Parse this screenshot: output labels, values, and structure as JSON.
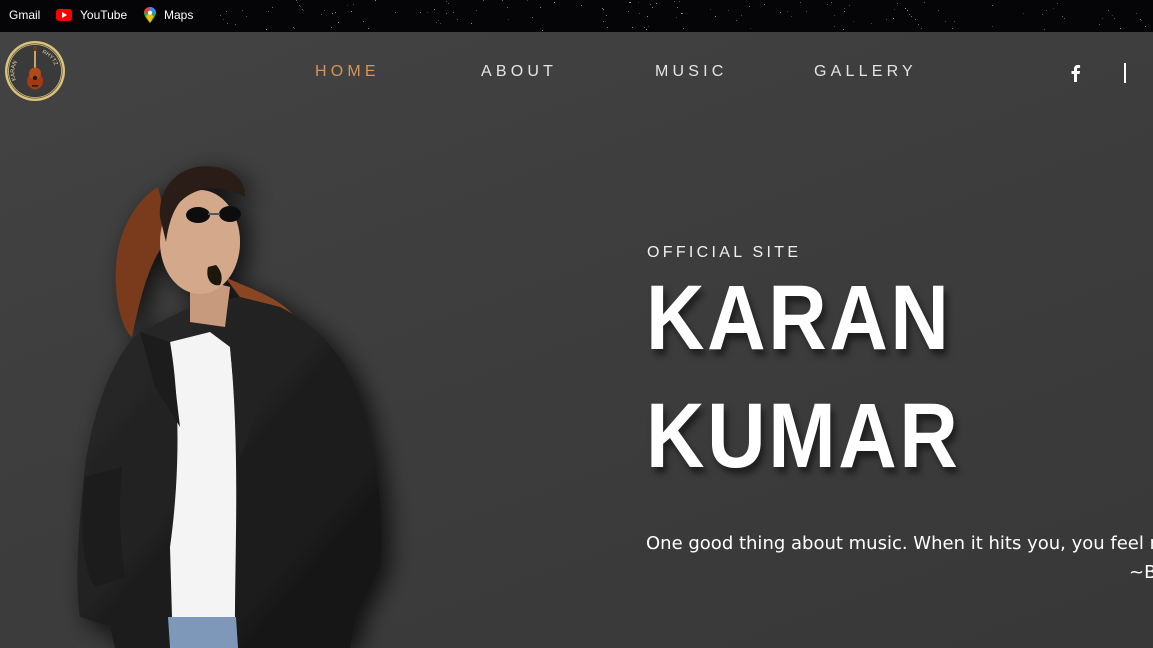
{
  "bookmarks": [
    {
      "label": "Gmail",
      "icon": "gmail-icon"
    },
    {
      "label": "YouTube",
      "icon": "youtube-icon"
    },
    {
      "label": "Maps",
      "icon": "maps-icon"
    }
  ],
  "logo": {
    "icon": "guitar-logo-icon",
    "text": "KARAN RHYTZ"
  },
  "nav": {
    "items": [
      "HOME",
      "ABOUT",
      "MUSIC",
      "GALLERY"
    ],
    "active": "HOME"
  },
  "social": {
    "icon": "facebook-icon"
  },
  "hero": {
    "subtitle": "OFFICIAL SITE",
    "name_line1": "KARAN",
    "name_line2": "KUMAR",
    "quote": "One good thing about music. When it hits you, you feel no pain.",
    "quote_author": "~Bob Marley"
  },
  "colors": {
    "background": "#3b3b3b",
    "nav_text": "#e4e4e4",
    "nav_active": "#d6935a",
    "bookmarks_bar": "#050507",
    "hero_text": "#ffffff"
  }
}
